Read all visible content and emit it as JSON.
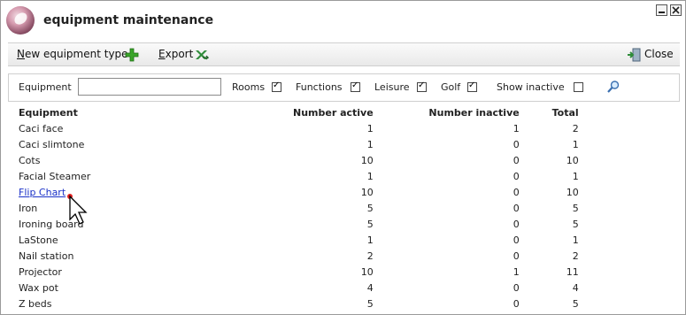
{
  "window": {
    "title": "equipment maintenance"
  },
  "toolbar": {
    "new_label_u": "N",
    "new_label_rest": "ew equipment type",
    "export_label_u": "E",
    "export_label_rest": "xport",
    "close_label": "Close"
  },
  "filters": {
    "equipment_label": "Equipment",
    "equipment_value": "",
    "rooms_label": "Rooms",
    "rooms_checked": true,
    "functions_label": "Functions",
    "functions_checked": true,
    "leisure_label": "Leisure",
    "leisure_checked": true,
    "golf_label": "Golf",
    "golf_checked": true,
    "inactive_label": "Show inactive",
    "inactive_checked": false
  },
  "table": {
    "headers": [
      "Equipment",
      "Number active",
      "Number inactive",
      "Total"
    ],
    "rows": [
      [
        "Caci face",
        "1",
        "1",
        "2"
      ],
      [
        "Caci slimtone",
        "1",
        "0",
        "1"
      ],
      [
        "Cots",
        "10",
        "0",
        "10"
      ],
      [
        "Facial Steamer",
        "1",
        "0",
        "1"
      ],
      [
        "Flip Chart",
        "10",
        "0",
        "10"
      ],
      [
        "Iron",
        "5",
        "0",
        "5"
      ],
      [
        "Ironing board",
        "5",
        "0",
        "5"
      ],
      [
        "LaStone",
        "1",
        "0",
        "1"
      ],
      [
        "Nail station",
        "2",
        "0",
        "2"
      ],
      [
        "Projector",
        "10",
        "1",
        "11"
      ],
      [
        "Wax pot",
        "4",
        "0",
        "4"
      ],
      [
        "Z beds",
        "5",
        "0",
        "5"
      ]
    ],
    "linked_row": 4
  },
  "colors": {
    "link": "#1a31c8",
    "accent_green": "#3aa52a"
  }
}
